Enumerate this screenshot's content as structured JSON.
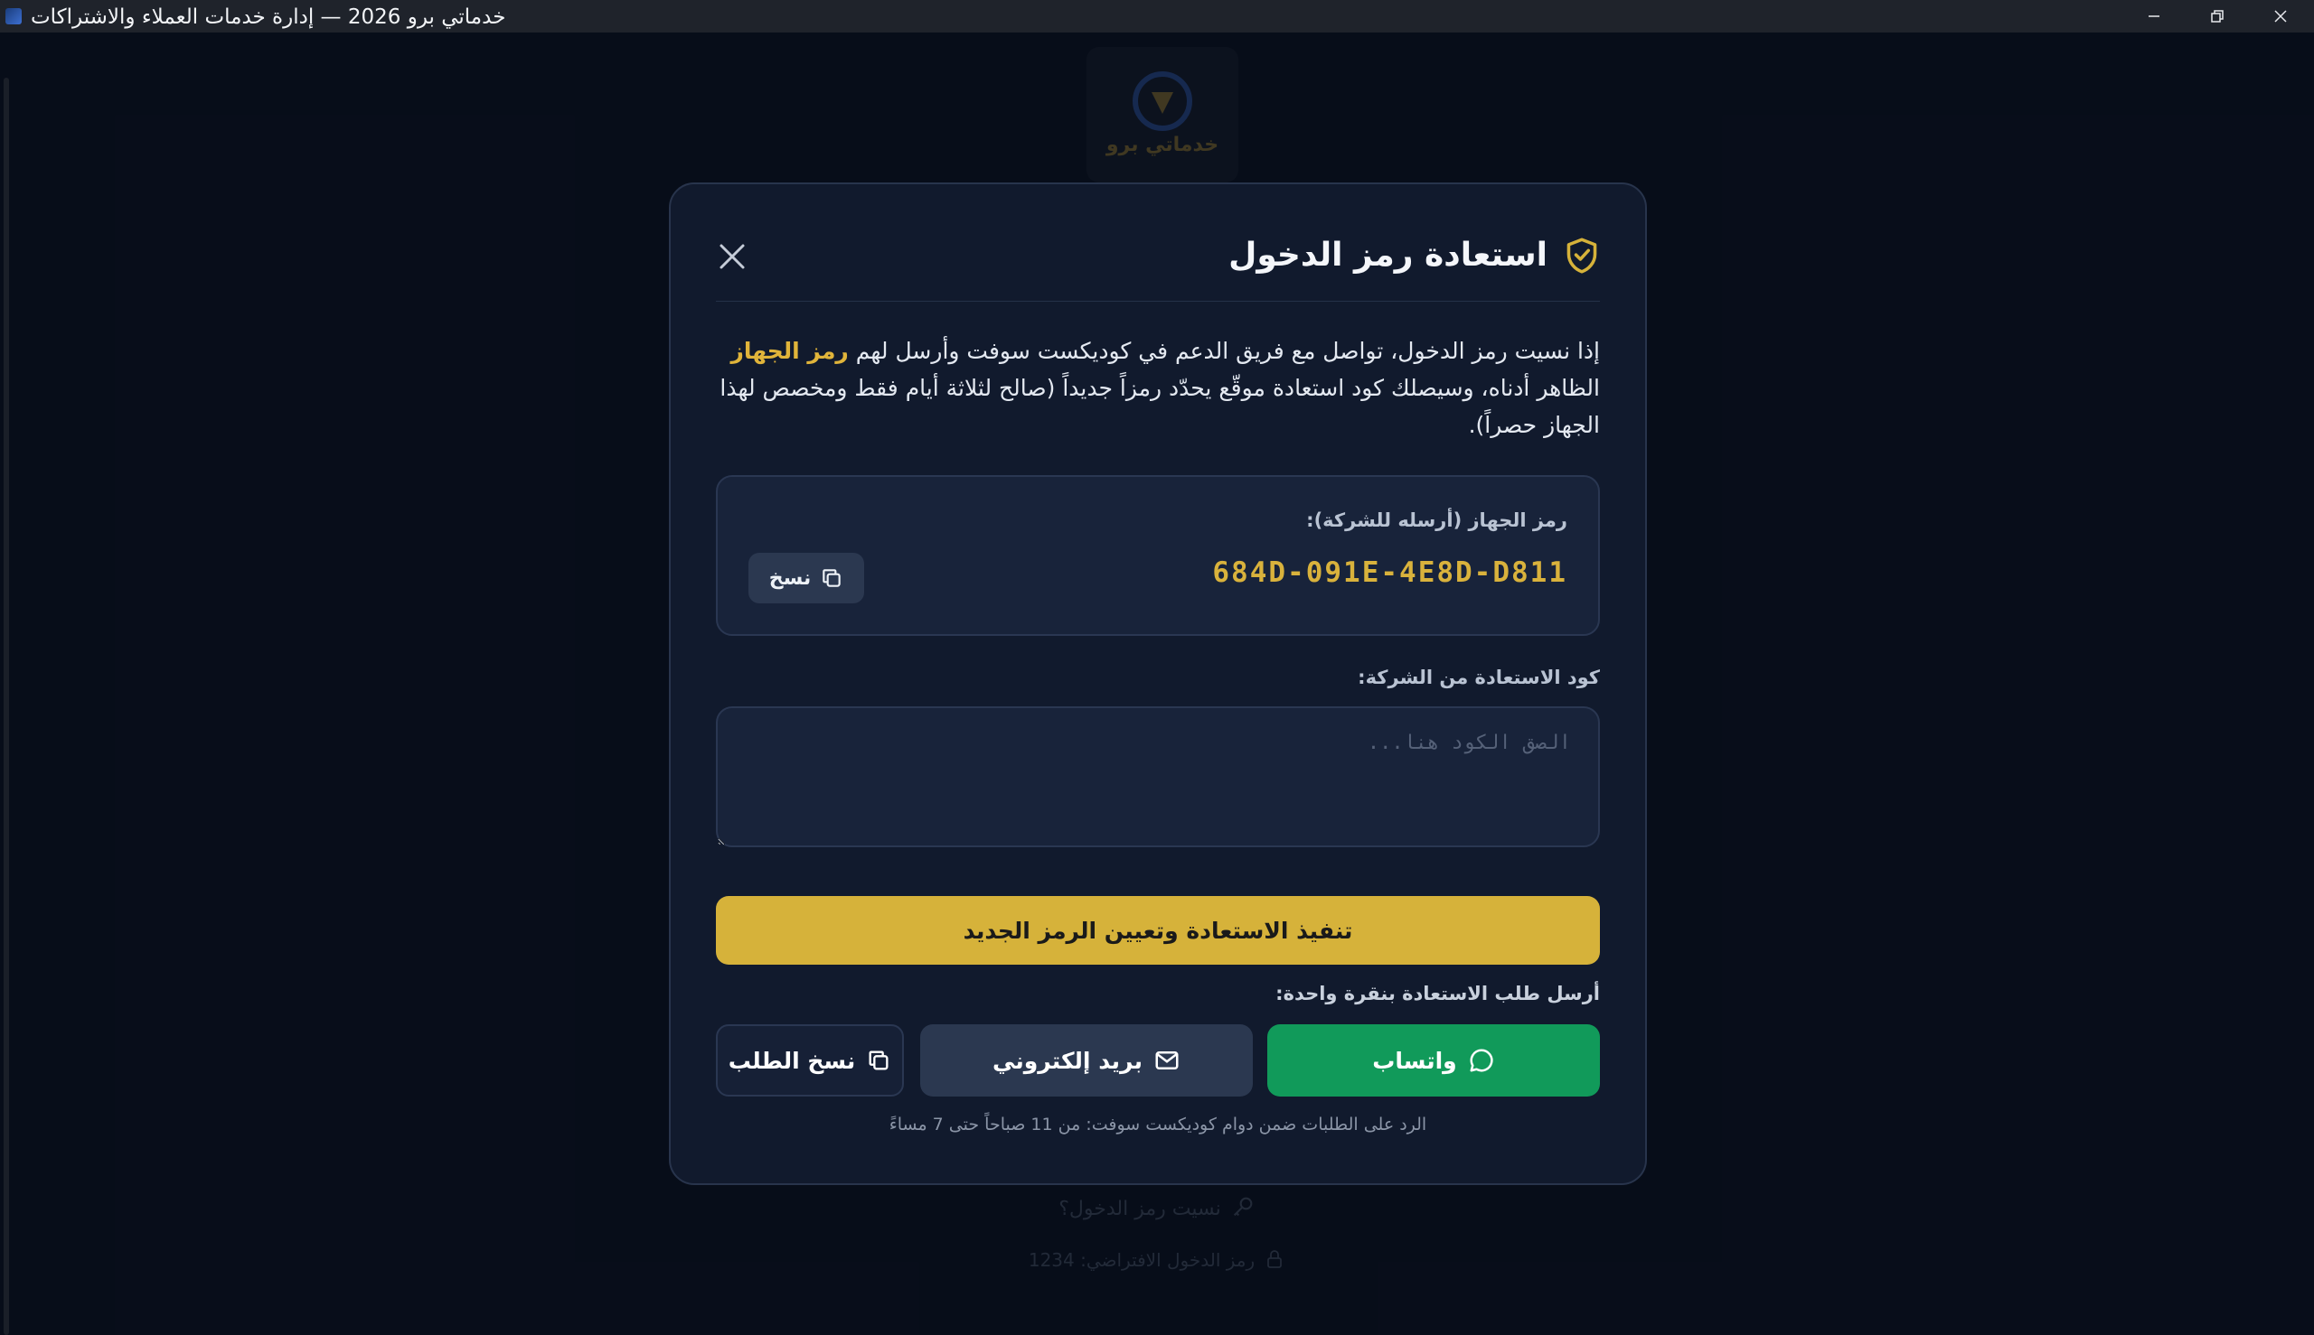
{
  "window": {
    "title": "خدماتي برو 2026 — إدارة خدمات العملاء والاشتراكات"
  },
  "background": {
    "logo_text": "خدماتي برو",
    "forgot_link": "نسيت رمز الدخول؟",
    "default_code_hint": "رمز الدخول الافتراضي: 1234"
  },
  "modal": {
    "title": "استعادة رمز الدخول",
    "desc_part1": "إذا نسيت رمز الدخول، تواصل مع فريق الدعم في كوديكست سوفت وأرسل لهم ",
    "desc_highlight": "رمز الجهاز",
    "desc_part2": " الظاهر أدناه، وسيصلك كود استعادة موقّع يحدّد رمزاً جديداً (صالح لثلاثة أيام فقط ومخصص لهذا الجهاز حصراً).",
    "device_label": "رمز الجهاز (أرسله للشركة):",
    "device_code": "684D-091E-4E8D-D811",
    "copy_label": "نسخ",
    "recovery_label": "كود الاستعادة من الشركة:",
    "recovery_placeholder": "الصق الكود هنا...",
    "submit_label": "تنفيذ الاستعادة وتعيين الرمز الجديد",
    "send_label": "أرسل طلب الاستعادة بنقرة واحدة:",
    "whatsapp_label": "واتساب",
    "email_label": "بريد إلكتروني",
    "copy_request_label": "نسخ الطلب",
    "hours_note": "الرد على الطلبات ضمن دوام كوديكست سوفت: من 11 صباحاً حتى 7 مساءً"
  },
  "colors": {
    "accent": "#d6b23a",
    "whatsapp": "#119a5a",
    "modal_bg": "#111a2d"
  }
}
